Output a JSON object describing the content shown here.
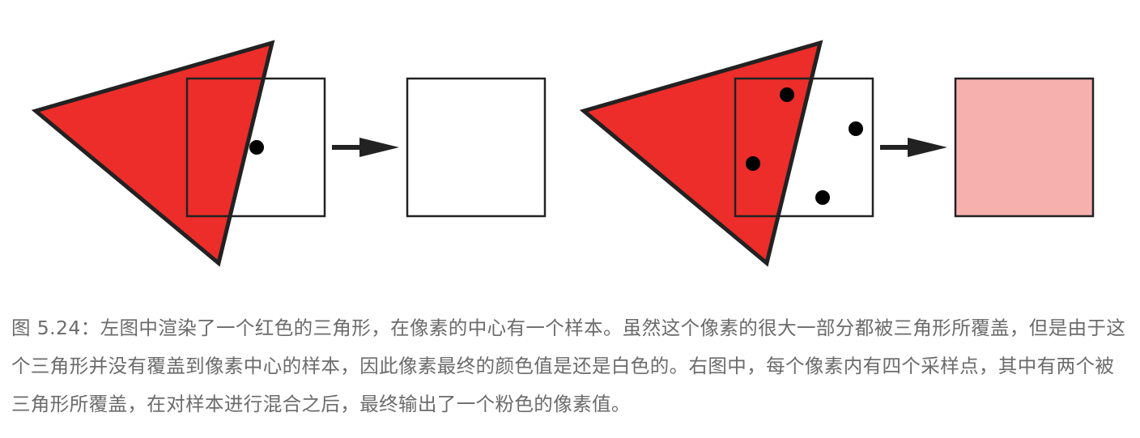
{
  "figure": {
    "colors": {
      "triangle_fill": "#ec2d2a",
      "outline": "#222222",
      "pixel_result_left": "#ffffff",
      "pixel_result_right": "#f6b0ae",
      "sample_dot": "#000000"
    },
    "left_panel": {
      "samples_per_pixel": 1,
      "samples_covered": 0,
      "result": "white"
    },
    "right_panel": {
      "samples_per_pixel": 4,
      "samples_covered": 2,
      "result": "pink"
    }
  },
  "caption": {
    "text": "图 5.24：左图中渲染了一个红色的三角形，在像素的中心有一个样本。虽然这个像素的很大一部分都被三角形所覆盖，但是由于这个三角形并没有覆盖到像素中心的样本，因此像素最终的颜色值是还是白色的。右图中，每个像素内有四个采样点，其中有两个被三角形所覆盖，在对样本进行混合之后，最终输出了一个粉色的像素值。"
  }
}
